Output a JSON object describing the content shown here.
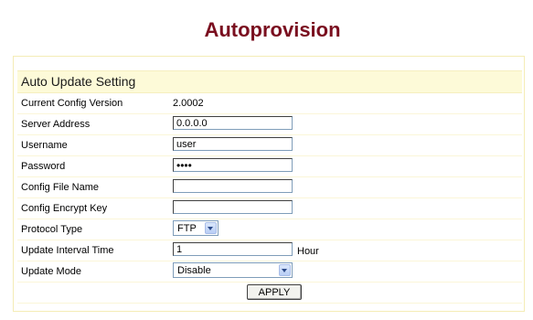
{
  "page": {
    "title": "Autoprovision"
  },
  "section": {
    "title": "Auto Update Setting"
  },
  "fields": {
    "current_config_version": {
      "label": "Current Config Version",
      "value": "2.0002"
    },
    "server_address": {
      "label": "Server Address",
      "value": "0.0.0.0"
    },
    "username": {
      "label": "Username",
      "value": "user"
    },
    "password": {
      "label": "Password",
      "value": "••••"
    },
    "config_file_name": {
      "label": "Config File Name",
      "value": ""
    },
    "config_encrypt_key": {
      "label": "Config Encrypt Key",
      "value": ""
    },
    "protocol_type": {
      "label": "Protocol Type",
      "selected": "FTP"
    },
    "update_interval_time": {
      "label": "Update Interval Time",
      "value": "1",
      "unit": "Hour"
    },
    "update_mode": {
      "label": "Update Mode",
      "selected": "Disable"
    }
  },
  "actions": {
    "apply_label": "APPLY"
  },
  "colors": {
    "title": "#7a0e1f",
    "section_header_bg": "#fdfad8",
    "border": "#f4ecb6"
  }
}
